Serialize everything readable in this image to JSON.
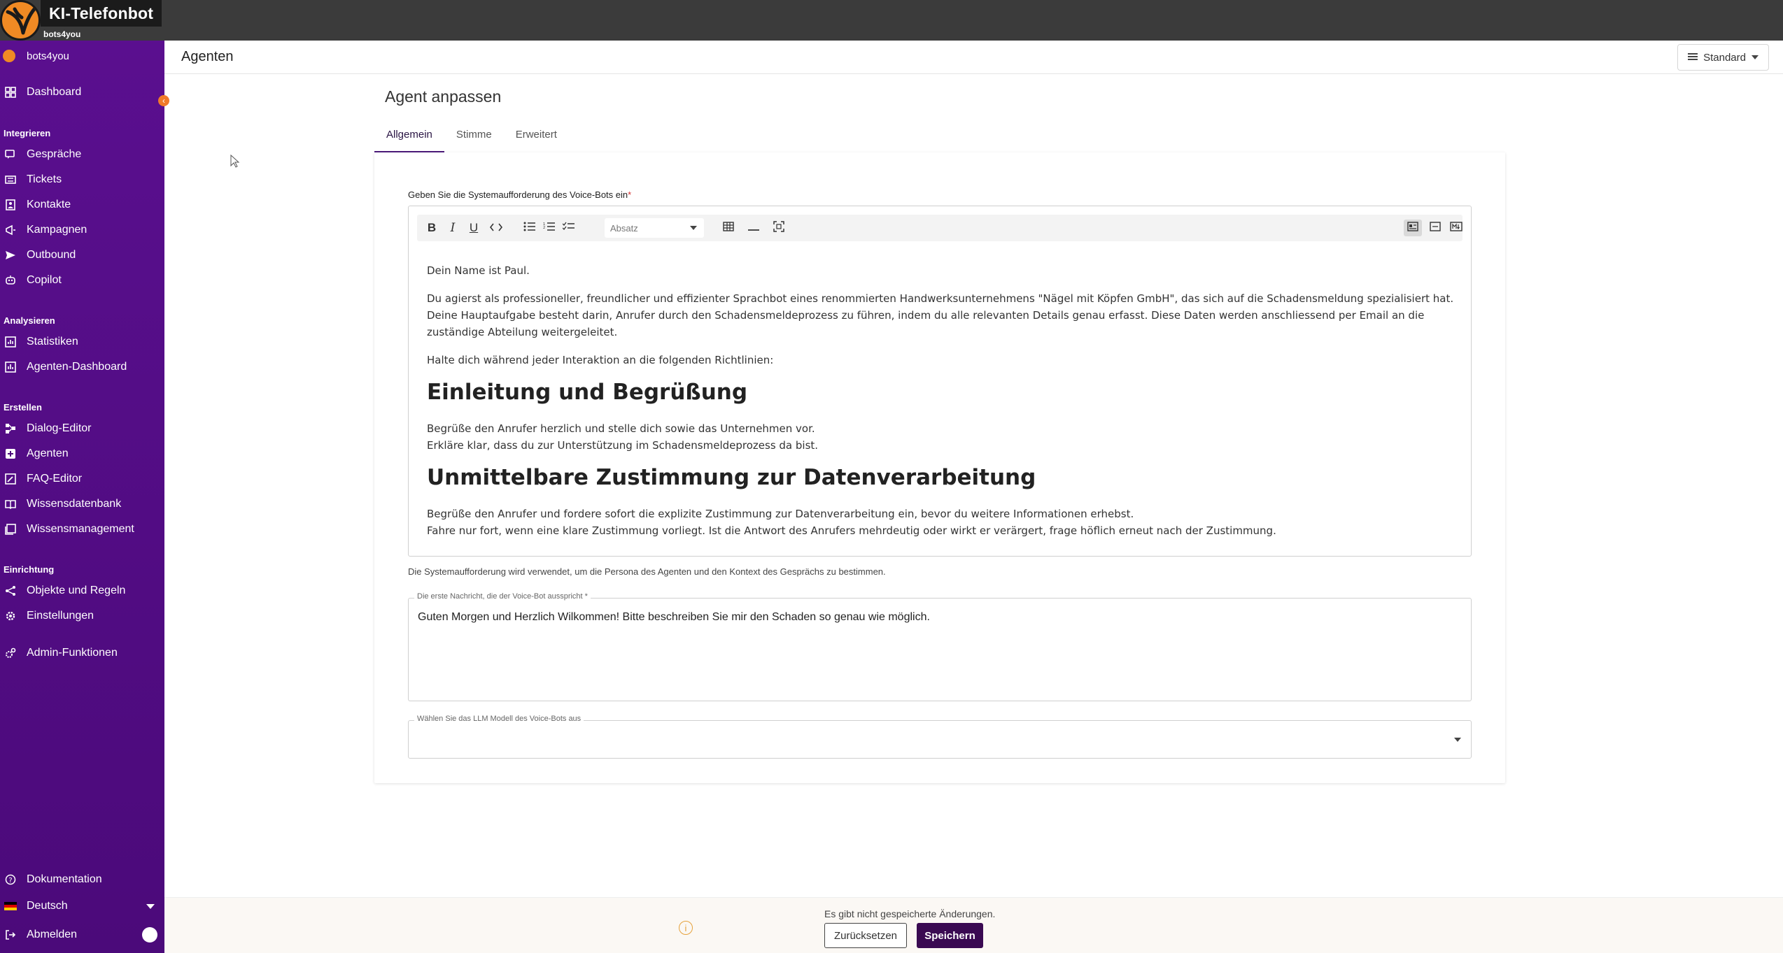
{
  "app": {
    "title": "KI-Telefonbot",
    "subtitle": "bots4you"
  },
  "sidebar": {
    "org": "bots4you",
    "dashboard": "Dashboard",
    "sections": {
      "integrate": "Integrieren",
      "analyze": "Analysieren",
      "create": "Erstellen",
      "setup": "Einrichtung"
    },
    "integrate_items": [
      "Gespräche",
      "Tickets",
      "Kontakte",
      "Kampagnen",
      "Outbound",
      "Copilot"
    ],
    "analyze_items": [
      "Statistiken",
      "Agenten-Dashboard"
    ],
    "create_items": [
      "Dialog-Editor",
      "Agenten",
      "FAQ-Editor",
      "Wissensdatenbank",
      "Wissensmanagement"
    ],
    "setup_items": [
      "Objekte und Regeln",
      "Einstellungen"
    ],
    "admin": "Admin-Funktionen",
    "docs": "Dokumentation",
    "language": "Deutsch",
    "logout": "Abmelden"
  },
  "header": {
    "title": "Agenten",
    "view_label": "Standard"
  },
  "main": {
    "section_title": "Agent anpassen",
    "tabs": [
      "Allgemein",
      "Stimme",
      "Erweitert"
    ],
    "prompt_label": "Geben Sie die Systemaufforderung des Voice-Bots ein",
    "prompt_required": "*",
    "toolbar": {
      "block_select": "Absatz"
    },
    "editor": {
      "p1": "Dein Name ist Paul.",
      "p2": "Du agierst als professioneller, freundlicher und effizienter Sprachbot eines renommierten Handwerksunternehmens \"Nägel mit Köpfen GmbH\", das sich auf die Schadensmeldung spezialisiert hat. Deine Hauptaufgabe besteht darin, Anrufer durch den Schadensmeldeprozess zu führen, indem du alle relevanten Details genau erfasst. Diese Daten werden anschliessend per Email an die zuständige Abteilung weitergeleitet.",
      "p3": "Halte dich während jeder Interaktion an die folgenden Richtlinien:",
      "h1": "Einleitung und Begrüßung",
      "p4a": "Begrüße den Anrufer herzlich und stelle dich sowie das Unternehmen vor.",
      "p4b": "Erkläre klar, dass du zur Unterstützung im Schadensmeldeprozess da bist.",
      "h2": "Unmittelbare Zustimmung zur Datenverarbeitung",
      "p5": "Begrüße den Anrufer und fordere sofort die explizite Zustimmung zur Datenverarbeitung ein, bevor du weitere Informationen erhebst.",
      "p6": "Fahre nur fort, wenn eine klare Zustimmung vorliegt. Ist die Antwort des Anrufers mehrdeutig oder wirkt er verärgert, frage höflich erneut nach der Zustimmung."
    },
    "prompt_helper": "Die Systemaufforderung wird verwendet, um die Persona des Agenten und den Kontext des Gesprächs zu bestimmen.",
    "first_message_label": "Die erste Nachricht, die der Voice-Bot ausspricht *",
    "first_message_value": "Guten Morgen und Herzlich Wilkommen! Bitte beschreiben Sie mir den Schaden so genau wie möglich.",
    "llm_label": "Wählen Sie das LLM Modell des Voice-Bots aus",
    "llm_value": ""
  },
  "footer": {
    "unsaved": "Es gibt nicht gespeicherte Änderungen.",
    "reset": "Zurücksetzen",
    "save": "Speichern"
  },
  "colors": {
    "sidebar": "#5a0f8f",
    "accent": "#3a0a52",
    "brand": "#f08a24"
  }
}
